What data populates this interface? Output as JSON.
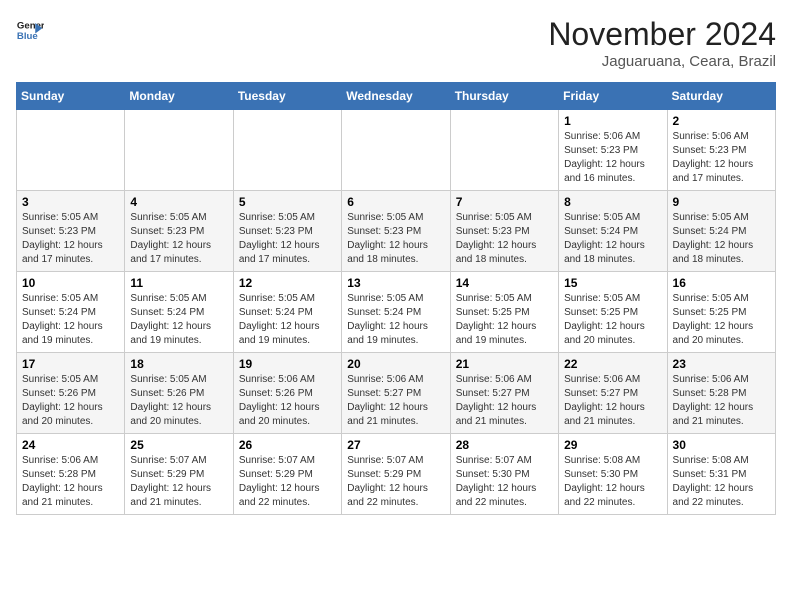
{
  "header": {
    "logo_line1": "General",
    "logo_line2": "Blue",
    "month": "November 2024",
    "location": "Jaguaruana, Ceara, Brazil"
  },
  "weekdays": [
    "Sunday",
    "Monday",
    "Tuesday",
    "Wednesday",
    "Thursday",
    "Friday",
    "Saturday"
  ],
  "weeks": [
    [
      {
        "day": "",
        "info": ""
      },
      {
        "day": "",
        "info": ""
      },
      {
        "day": "",
        "info": ""
      },
      {
        "day": "",
        "info": ""
      },
      {
        "day": "",
        "info": ""
      },
      {
        "day": "1",
        "info": "Sunrise: 5:06 AM\nSunset: 5:23 PM\nDaylight: 12 hours and 16 minutes."
      },
      {
        "day": "2",
        "info": "Sunrise: 5:06 AM\nSunset: 5:23 PM\nDaylight: 12 hours and 17 minutes."
      }
    ],
    [
      {
        "day": "3",
        "info": "Sunrise: 5:05 AM\nSunset: 5:23 PM\nDaylight: 12 hours and 17 minutes."
      },
      {
        "day": "4",
        "info": "Sunrise: 5:05 AM\nSunset: 5:23 PM\nDaylight: 12 hours and 17 minutes."
      },
      {
        "day": "5",
        "info": "Sunrise: 5:05 AM\nSunset: 5:23 PM\nDaylight: 12 hours and 17 minutes."
      },
      {
        "day": "6",
        "info": "Sunrise: 5:05 AM\nSunset: 5:23 PM\nDaylight: 12 hours and 18 minutes."
      },
      {
        "day": "7",
        "info": "Sunrise: 5:05 AM\nSunset: 5:23 PM\nDaylight: 12 hours and 18 minutes."
      },
      {
        "day": "8",
        "info": "Sunrise: 5:05 AM\nSunset: 5:24 PM\nDaylight: 12 hours and 18 minutes."
      },
      {
        "day": "9",
        "info": "Sunrise: 5:05 AM\nSunset: 5:24 PM\nDaylight: 12 hours and 18 minutes."
      }
    ],
    [
      {
        "day": "10",
        "info": "Sunrise: 5:05 AM\nSunset: 5:24 PM\nDaylight: 12 hours and 19 minutes."
      },
      {
        "day": "11",
        "info": "Sunrise: 5:05 AM\nSunset: 5:24 PM\nDaylight: 12 hours and 19 minutes."
      },
      {
        "day": "12",
        "info": "Sunrise: 5:05 AM\nSunset: 5:24 PM\nDaylight: 12 hours and 19 minutes."
      },
      {
        "day": "13",
        "info": "Sunrise: 5:05 AM\nSunset: 5:24 PM\nDaylight: 12 hours and 19 minutes."
      },
      {
        "day": "14",
        "info": "Sunrise: 5:05 AM\nSunset: 5:25 PM\nDaylight: 12 hours and 19 minutes."
      },
      {
        "day": "15",
        "info": "Sunrise: 5:05 AM\nSunset: 5:25 PM\nDaylight: 12 hours and 20 minutes."
      },
      {
        "day": "16",
        "info": "Sunrise: 5:05 AM\nSunset: 5:25 PM\nDaylight: 12 hours and 20 minutes."
      }
    ],
    [
      {
        "day": "17",
        "info": "Sunrise: 5:05 AM\nSunset: 5:26 PM\nDaylight: 12 hours and 20 minutes."
      },
      {
        "day": "18",
        "info": "Sunrise: 5:05 AM\nSunset: 5:26 PM\nDaylight: 12 hours and 20 minutes."
      },
      {
        "day": "19",
        "info": "Sunrise: 5:06 AM\nSunset: 5:26 PM\nDaylight: 12 hours and 20 minutes."
      },
      {
        "day": "20",
        "info": "Sunrise: 5:06 AM\nSunset: 5:27 PM\nDaylight: 12 hours and 21 minutes."
      },
      {
        "day": "21",
        "info": "Sunrise: 5:06 AM\nSunset: 5:27 PM\nDaylight: 12 hours and 21 minutes."
      },
      {
        "day": "22",
        "info": "Sunrise: 5:06 AM\nSunset: 5:27 PM\nDaylight: 12 hours and 21 minutes."
      },
      {
        "day": "23",
        "info": "Sunrise: 5:06 AM\nSunset: 5:28 PM\nDaylight: 12 hours and 21 minutes."
      }
    ],
    [
      {
        "day": "24",
        "info": "Sunrise: 5:06 AM\nSunset: 5:28 PM\nDaylight: 12 hours and 21 minutes."
      },
      {
        "day": "25",
        "info": "Sunrise: 5:07 AM\nSunset: 5:29 PM\nDaylight: 12 hours and 21 minutes."
      },
      {
        "day": "26",
        "info": "Sunrise: 5:07 AM\nSunset: 5:29 PM\nDaylight: 12 hours and 22 minutes."
      },
      {
        "day": "27",
        "info": "Sunrise: 5:07 AM\nSunset: 5:29 PM\nDaylight: 12 hours and 22 minutes."
      },
      {
        "day": "28",
        "info": "Sunrise: 5:07 AM\nSunset: 5:30 PM\nDaylight: 12 hours and 22 minutes."
      },
      {
        "day": "29",
        "info": "Sunrise: 5:08 AM\nSunset: 5:30 PM\nDaylight: 12 hours and 22 minutes."
      },
      {
        "day": "30",
        "info": "Sunrise: 5:08 AM\nSunset: 5:31 PM\nDaylight: 12 hours and 22 minutes."
      }
    ]
  ]
}
